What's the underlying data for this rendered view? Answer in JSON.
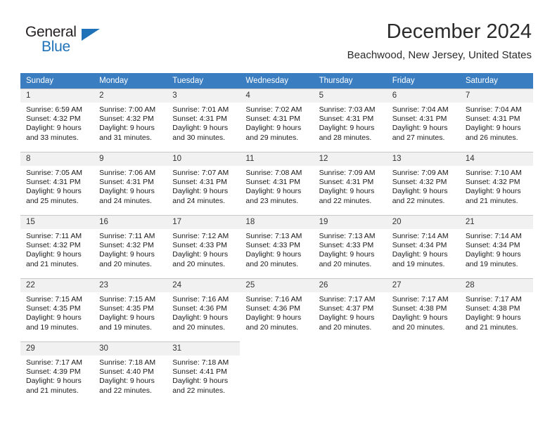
{
  "brand": {
    "name_top": "General",
    "name_bottom": "Blue",
    "accent_color": "#1f72b8"
  },
  "header": {
    "title": "December 2024",
    "subtitle": "Beachwood, New Jersey, United States",
    "header_bg_color": "#3a7dc0",
    "daynum_bg_color": "#f1f1f1"
  },
  "weekdays": [
    "Sunday",
    "Monday",
    "Tuesday",
    "Wednesday",
    "Thursday",
    "Friday",
    "Saturday"
  ],
  "weeks": [
    [
      {
        "day": "1",
        "sunrise": "Sunrise: 6:59 AM",
        "sunset": "Sunset: 4:32 PM",
        "daylight1": "Daylight: 9 hours",
        "daylight2": "and 33 minutes."
      },
      {
        "day": "2",
        "sunrise": "Sunrise: 7:00 AM",
        "sunset": "Sunset: 4:32 PM",
        "daylight1": "Daylight: 9 hours",
        "daylight2": "and 31 minutes."
      },
      {
        "day": "3",
        "sunrise": "Sunrise: 7:01 AM",
        "sunset": "Sunset: 4:31 PM",
        "daylight1": "Daylight: 9 hours",
        "daylight2": "and 30 minutes."
      },
      {
        "day": "4",
        "sunrise": "Sunrise: 7:02 AM",
        "sunset": "Sunset: 4:31 PM",
        "daylight1": "Daylight: 9 hours",
        "daylight2": "and 29 minutes."
      },
      {
        "day": "5",
        "sunrise": "Sunrise: 7:03 AM",
        "sunset": "Sunset: 4:31 PM",
        "daylight1": "Daylight: 9 hours",
        "daylight2": "and 28 minutes."
      },
      {
        "day": "6",
        "sunrise": "Sunrise: 7:04 AM",
        "sunset": "Sunset: 4:31 PM",
        "daylight1": "Daylight: 9 hours",
        "daylight2": "and 27 minutes."
      },
      {
        "day": "7",
        "sunrise": "Sunrise: 7:04 AM",
        "sunset": "Sunset: 4:31 PM",
        "daylight1": "Daylight: 9 hours",
        "daylight2": "and 26 minutes."
      }
    ],
    [
      {
        "day": "8",
        "sunrise": "Sunrise: 7:05 AM",
        "sunset": "Sunset: 4:31 PM",
        "daylight1": "Daylight: 9 hours",
        "daylight2": "and 25 minutes."
      },
      {
        "day": "9",
        "sunrise": "Sunrise: 7:06 AM",
        "sunset": "Sunset: 4:31 PM",
        "daylight1": "Daylight: 9 hours",
        "daylight2": "and 24 minutes."
      },
      {
        "day": "10",
        "sunrise": "Sunrise: 7:07 AM",
        "sunset": "Sunset: 4:31 PM",
        "daylight1": "Daylight: 9 hours",
        "daylight2": "and 24 minutes."
      },
      {
        "day": "11",
        "sunrise": "Sunrise: 7:08 AM",
        "sunset": "Sunset: 4:31 PM",
        "daylight1": "Daylight: 9 hours",
        "daylight2": "and 23 minutes."
      },
      {
        "day": "12",
        "sunrise": "Sunrise: 7:09 AM",
        "sunset": "Sunset: 4:31 PM",
        "daylight1": "Daylight: 9 hours",
        "daylight2": "and 22 minutes."
      },
      {
        "day": "13",
        "sunrise": "Sunrise: 7:09 AM",
        "sunset": "Sunset: 4:32 PM",
        "daylight1": "Daylight: 9 hours",
        "daylight2": "and 22 minutes."
      },
      {
        "day": "14",
        "sunrise": "Sunrise: 7:10 AM",
        "sunset": "Sunset: 4:32 PM",
        "daylight1": "Daylight: 9 hours",
        "daylight2": "and 21 minutes."
      }
    ],
    [
      {
        "day": "15",
        "sunrise": "Sunrise: 7:11 AM",
        "sunset": "Sunset: 4:32 PM",
        "daylight1": "Daylight: 9 hours",
        "daylight2": "and 21 minutes."
      },
      {
        "day": "16",
        "sunrise": "Sunrise: 7:11 AM",
        "sunset": "Sunset: 4:32 PM",
        "daylight1": "Daylight: 9 hours",
        "daylight2": "and 20 minutes."
      },
      {
        "day": "17",
        "sunrise": "Sunrise: 7:12 AM",
        "sunset": "Sunset: 4:33 PM",
        "daylight1": "Daylight: 9 hours",
        "daylight2": "and 20 minutes."
      },
      {
        "day": "18",
        "sunrise": "Sunrise: 7:13 AM",
        "sunset": "Sunset: 4:33 PM",
        "daylight1": "Daylight: 9 hours",
        "daylight2": "and 20 minutes."
      },
      {
        "day": "19",
        "sunrise": "Sunrise: 7:13 AM",
        "sunset": "Sunset: 4:33 PM",
        "daylight1": "Daylight: 9 hours",
        "daylight2": "and 20 minutes."
      },
      {
        "day": "20",
        "sunrise": "Sunrise: 7:14 AM",
        "sunset": "Sunset: 4:34 PM",
        "daylight1": "Daylight: 9 hours",
        "daylight2": "and 19 minutes."
      },
      {
        "day": "21",
        "sunrise": "Sunrise: 7:14 AM",
        "sunset": "Sunset: 4:34 PM",
        "daylight1": "Daylight: 9 hours",
        "daylight2": "and 19 minutes."
      }
    ],
    [
      {
        "day": "22",
        "sunrise": "Sunrise: 7:15 AM",
        "sunset": "Sunset: 4:35 PM",
        "daylight1": "Daylight: 9 hours",
        "daylight2": "and 19 minutes."
      },
      {
        "day": "23",
        "sunrise": "Sunrise: 7:15 AM",
        "sunset": "Sunset: 4:35 PM",
        "daylight1": "Daylight: 9 hours",
        "daylight2": "and 19 minutes."
      },
      {
        "day": "24",
        "sunrise": "Sunrise: 7:16 AM",
        "sunset": "Sunset: 4:36 PM",
        "daylight1": "Daylight: 9 hours",
        "daylight2": "and 20 minutes."
      },
      {
        "day": "25",
        "sunrise": "Sunrise: 7:16 AM",
        "sunset": "Sunset: 4:36 PM",
        "daylight1": "Daylight: 9 hours",
        "daylight2": "and 20 minutes."
      },
      {
        "day": "26",
        "sunrise": "Sunrise: 7:17 AM",
        "sunset": "Sunset: 4:37 PM",
        "daylight1": "Daylight: 9 hours",
        "daylight2": "and 20 minutes."
      },
      {
        "day": "27",
        "sunrise": "Sunrise: 7:17 AM",
        "sunset": "Sunset: 4:38 PM",
        "daylight1": "Daylight: 9 hours",
        "daylight2": "and 20 minutes."
      },
      {
        "day": "28",
        "sunrise": "Sunrise: 7:17 AM",
        "sunset": "Sunset: 4:38 PM",
        "daylight1": "Daylight: 9 hours",
        "daylight2": "and 21 minutes."
      }
    ],
    [
      {
        "day": "29",
        "sunrise": "Sunrise: 7:17 AM",
        "sunset": "Sunset: 4:39 PM",
        "daylight1": "Daylight: 9 hours",
        "daylight2": "and 21 minutes."
      },
      {
        "day": "30",
        "sunrise": "Sunrise: 7:18 AM",
        "sunset": "Sunset: 4:40 PM",
        "daylight1": "Daylight: 9 hours",
        "daylight2": "and 22 minutes."
      },
      {
        "day": "31",
        "sunrise": "Sunrise: 7:18 AM",
        "sunset": "Sunset: 4:41 PM",
        "daylight1": "Daylight: 9 hours",
        "daylight2": "and 22 minutes."
      },
      {
        "day": "",
        "sunrise": "",
        "sunset": "",
        "daylight1": "",
        "daylight2": ""
      },
      {
        "day": "",
        "sunrise": "",
        "sunset": "",
        "daylight1": "",
        "daylight2": ""
      },
      {
        "day": "",
        "sunrise": "",
        "sunset": "",
        "daylight1": "",
        "daylight2": ""
      },
      {
        "day": "",
        "sunrise": "",
        "sunset": "",
        "daylight1": "",
        "daylight2": ""
      }
    ]
  ]
}
